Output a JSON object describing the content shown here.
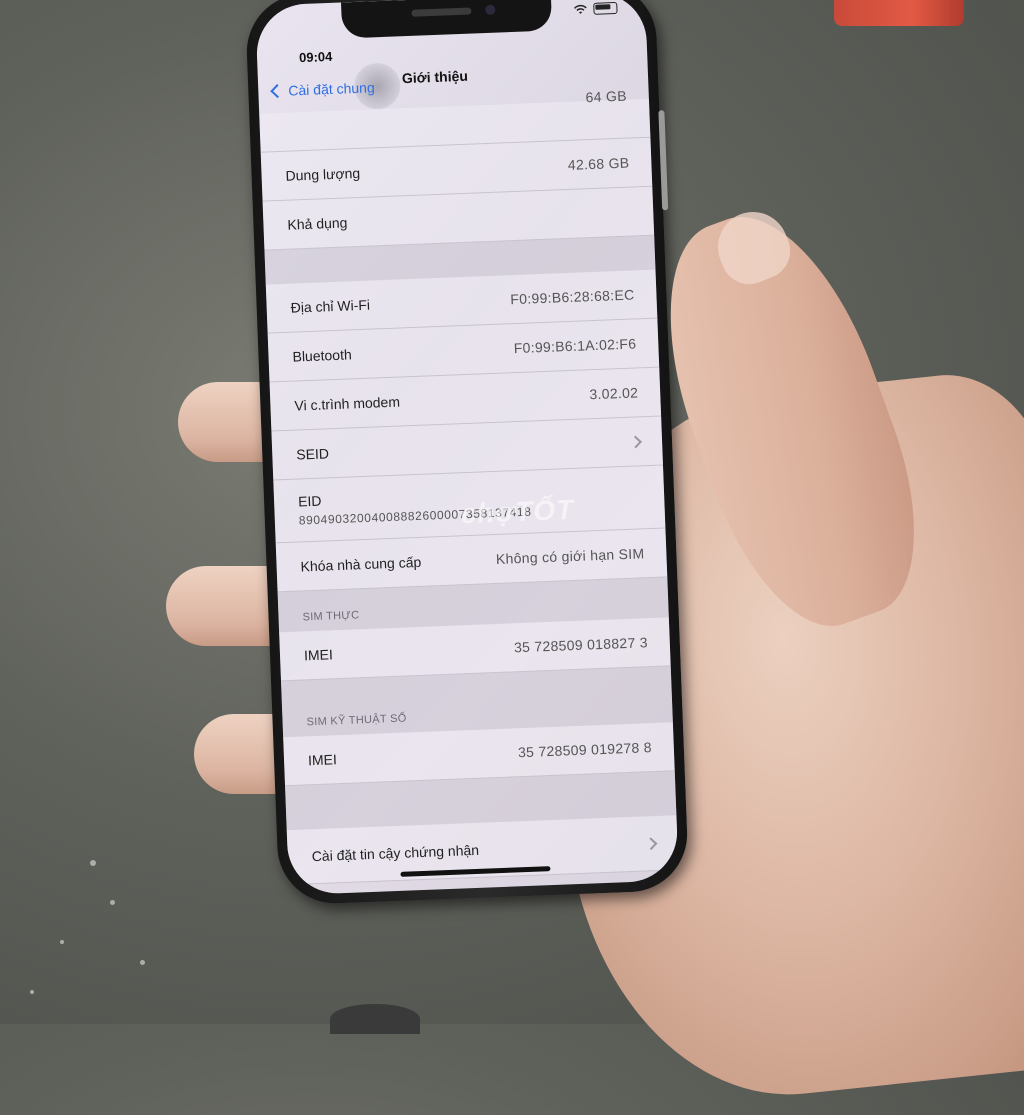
{
  "status_bar": {
    "time": "09:04",
    "wifi_icon": "wifi-icon",
    "battery_icon": "battery-icon"
  },
  "nav": {
    "back_label": "Cài đặt chung",
    "title": "Giới thiệu"
  },
  "rows_top": [
    {
      "label": "",
      "value": "64 GB"
    },
    {
      "label": "Dung lượng",
      "value": "42.68 GB"
    },
    {
      "label": "Khả dụng",
      "value": ""
    }
  ],
  "rows_net": [
    {
      "label": "Địa chỉ Wi-Fi",
      "value": "F0:99:B6:28:68:EC"
    },
    {
      "label": "Bluetooth",
      "value": "F0:99:B6:1A:02:F6"
    },
    {
      "label": "Vi c.trình modem",
      "value": "3.02.02"
    },
    {
      "label": "SEID",
      "value": ""
    }
  ],
  "eid": {
    "label": "EID",
    "value": "89049032004008882600007358137418"
  },
  "carrier_lock": {
    "label": "Khóa nhà cung cấp",
    "value": "Không có giới hạn SIM"
  },
  "sim_physical": {
    "header": "SIM THỰC",
    "label": "IMEI",
    "value": "35 728509 018827 3"
  },
  "sim_digital": {
    "header": "SIM KỸ THUẬT SỐ",
    "label": "IMEI",
    "value": "35 728509 019278 8"
  },
  "trust": {
    "label": "Cài đặt tin cậy chứng nhận"
  },
  "watermark": "chợTỐT",
  "colors": {
    "accent": "#2f6fe3",
    "phone_body": "#1a1a1a",
    "screen_bg": "#e4dfe9"
  }
}
